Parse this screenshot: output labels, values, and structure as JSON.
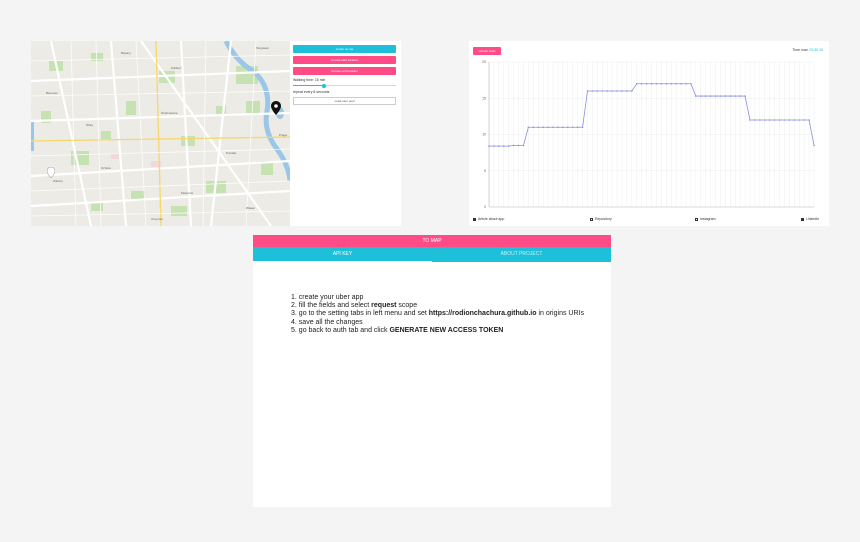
{
  "map_panel": {
    "buttons": {
      "center": "center on me",
      "set_start": "choose start location",
      "set_end": "choose end location"
    },
    "walking_time": "Walking time: 15 min",
    "walking_fraction": 0.3,
    "repeat_text": "repeat every 8 seconds",
    "load_button": "Load user pool",
    "labels": [
      "Wola",
      "Ochota",
      "Śródmieście",
      "Mokotów",
      "Żoliborz",
      "Praga",
      "Ursynów",
      "Bemowo",
      "Bielany",
      "Włochy",
      "Wawer",
      "Targówek",
      "Powiśle"
    ],
    "icons": [
      "pin-dark-icon",
      "pin-white-icon"
    ]
  },
  "chart_panel": {
    "button": "refresh chart",
    "time_now_label": "Time now:",
    "time_now_value": "20:30:15",
    "footer": [
      "Article about app",
      "Repository",
      "Instagram",
      "LinkedIn"
    ],
    "accent": "#1ec0d9",
    "line_color": "#8a8fe0"
  },
  "chart_data": {
    "type": "line",
    "title": "",
    "xlabel": "",
    "ylabel": "",
    "ylim": [
      0,
      20
    ],
    "yticks": [
      "0",
      "5",
      "10",
      "15",
      "20"
    ],
    "x": [
      0,
      1,
      2,
      3,
      4,
      5,
      6,
      7,
      8,
      9,
      10,
      11,
      12,
      13,
      14,
      15,
      16,
      17,
      18,
      19,
      20,
      21,
      22,
      23,
      24,
      25,
      26,
      27,
      28,
      29,
      30,
      31,
      32,
      33,
      34,
      35,
      36,
      37,
      38,
      39,
      40,
      41,
      42,
      43,
      44,
      45,
      46,
      47,
      48,
      49,
      50,
      51,
      52,
      53,
      54,
      55,
      56,
      57,
      58,
      59,
      60,
      61,
      62,
      63,
      64,
      65,
      66
    ],
    "series": [
      {
        "values": [
          8.4,
          8.4,
          8.4,
          8.4,
          8.4,
          8.5,
          8.5,
          8.5,
          11,
          11,
          11,
          11,
          11,
          11,
          11,
          11,
          11,
          11,
          11,
          11,
          16,
          16,
          16,
          16,
          16,
          16,
          16,
          16,
          16,
          16,
          17,
          17,
          17,
          17,
          17,
          17,
          17,
          17,
          17,
          17,
          17,
          17,
          15.3,
          15.3,
          15.3,
          15.3,
          15.3,
          15.3,
          15.3,
          15.3,
          15.3,
          15.3,
          15.3,
          12,
          12,
          12,
          12,
          12,
          12,
          12,
          12,
          12,
          12,
          12,
          12,
          12,
          8.5
        ]
      }
    ]
  },
  "instructions": {
    "to_map": "TO MAP",
    "tabs": [
      "API KEY",
      "ABOUT PROJECT"
    ],
    "steps": [
      {
        "num": "1.",
        "pre": "create your uber app",
        "bold": "",
        "post": ""
      },
      {
        "num": "2.",
        "pre": "fill the fields and select ",
        "bold": "request",
        "post": " scope"
      },
      {
        "num": "3.",
        "pre": "go to the setting tabs in left menu and set ",
        "bold": "https://rodionchachura.github.io",
        "post": " in origins URIs"
      },
      {
        "num": "4.",
        "pre": "save all the changes",
        "bold": "",
        "post": ""
      },
      {
        "num": "5.",
        "pre": "go back to auth tab and click ",
        "bold": "GENERATE NEW ACCESS TOKEN",
        "post": ""
      }
    ]
  }
}
